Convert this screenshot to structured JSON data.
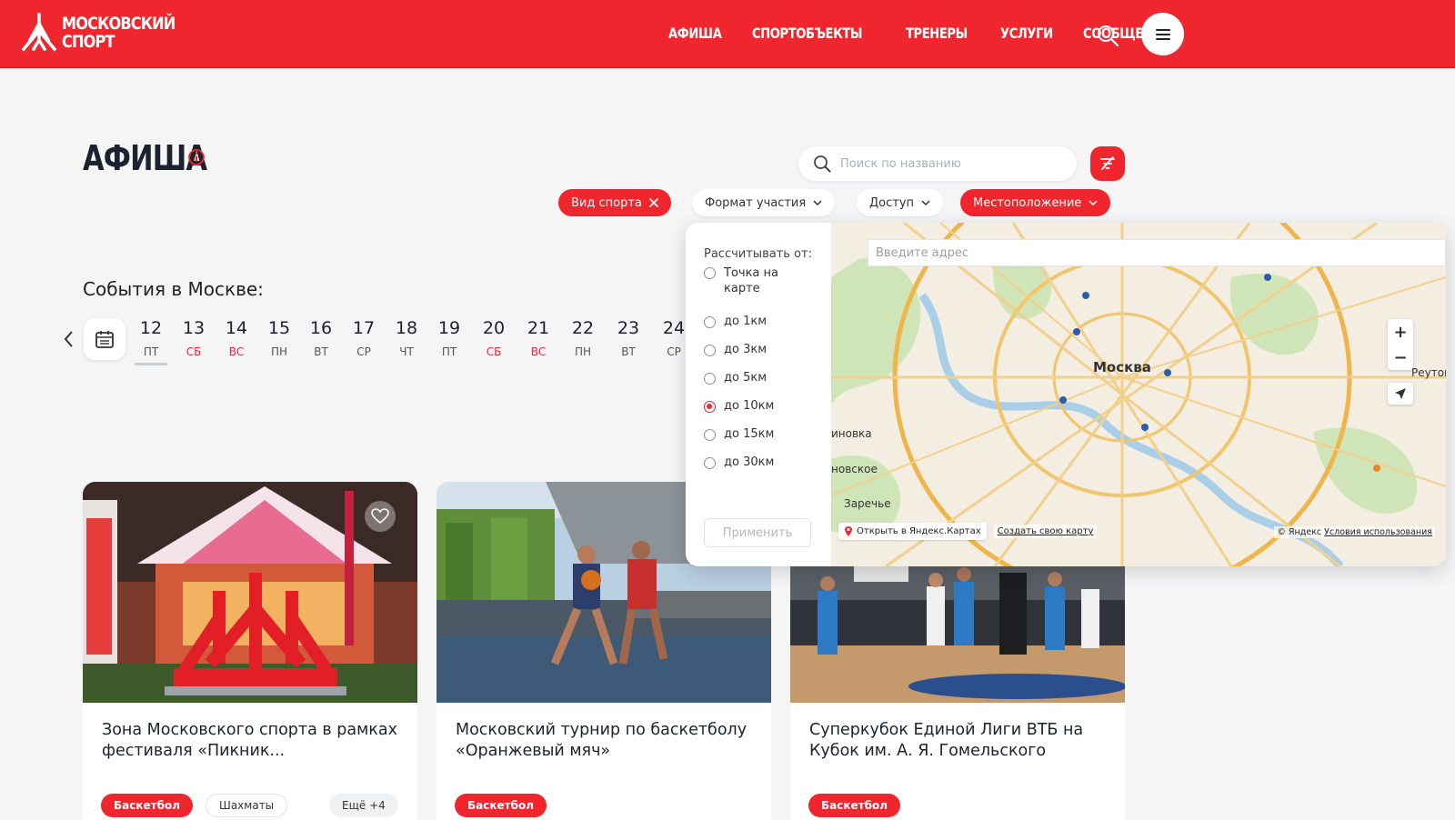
{
  "header": {
    "logo_line1": "МОСКОВСКИЙ",
    "logo_line2": "СПОРТ",
    "nav": [
      "АФИША",
      "СПОРТОБЪЕКТЫ",
      "ТРЕНЕРЫ",
      "УСЛУГИ",
      "СООБЩЕСТВО"
    ]
  },
  "page": {
    "title": "АФИША"
  },
  "search": {
    "placeholder": "Поиск по названию"
  },
  "filters": {
    "sport": "Вид спорта",
    "format": "Формат участия",
    "access": "Доступ",
    "location": "Местоположение"
  },
  "events": {
    "title": "События в Москве:",
    "days": [
      {
        "num": "12",
        "dow": "ПТ",
        "weekend": false,
        "active": true
      },
      {
        "num": "13",
        "dow": "СБ",
        "weekend": true
      },
      {
        "num": "14",
        "dow": "ВС",
        "weekend": true
      },
      {
        "num": "15",
        "dow": "ПН",
        "weekend": false
      },
      {
        "num": "16",
        "dow": "ВТ",
        "weekend": false
      },
      {
        "num": "17",
        "dow": "СР",
        "weekend": false
      },
      {
        "num": "18",
        "dow": "ЧТ",
        "weekend": false
      },
      {
        "num": "19",
        "dow": "ПТ",
        "weekend": false
      },
      {
        "num": "20",
        "dow": "СБ",
        "weekend": true
      },
      {
        "num": "21",
        "dow": "ВС",
        "weekend": true
      },
      {
        "num": "22",
        "dow": "ПН",
        "weekend": false
      },
      {
        "num": "23",
        "dow": "ВТ",
        "weekend": false
      },
      {
        "num": "24",
        "dow": "СР",
        "weekend": false
      }
    ]
  },
  "cards": [
    {
      "title": "Зона Московского спорта в рамках фестиваля «Пикник...",
      "tags": [
        "Баскетбол",
        "Шахматы"
      ],
      "more": "Ещё +4"
    },
    {
      "title": "Московский турнир по баскетболу «Оранжевый мяч»",
      "tags": [
        "Баскетбол"
      ]
    },
    {
      "title": "Суперкубок Единой Лиги ВТБ на Кубок им. А. Я. Гомельского",
      "tags": [
        "Баскетбол"
      ]
    }
  ],
  "location_popup": {
    "calc_label": "Рассчитывать от:",
    "options": [
      "Точка на карте",
      "до 1км",
      "до 3км",
      "до 5км",
      "до 10км",
      "до 15км",
      "до 30км"
    ],
    "selected": "до 10км",
    "apply": "Применить",
    "address_placeholder": "Введите адрес",
    "map": {
      "city": "Москва",
      "labels": [
        "Реутов",
        "Заречье",
        "иновка",
        "новское"
      ],
      "open_in": "Открыть в Яндекс.Картах",
      "create_map": "Создать свою карту",
      "copyright": "© Яндекс",
      "terms": "Условия использования"
    }
  },
  "colors": {
    "brand": "#f0262e",
    "text_dark": "#1c2230"
  }
}
